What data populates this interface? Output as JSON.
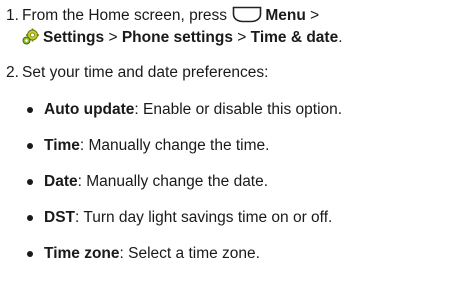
{
  "steps": [
    {
      "number": "1.",
      "line1": {
        "prefix": "From the Home screen, press",
        "key_icon": "menu-key-icon",
        "menu_label": "Menu",
        "arrow": ">"
      },
      "line2": {
        "icon": "settings-icon",
        "settings_label": "Settings",
        "sep1": ">",
        "phone_settings_label": "Phone settings",
        "sep2": ">",
        "time_date_label": "Time & date",
        "end": "."
      }
    },
    {
      "number": "2.",
      "text": "Set your time and date preferences:"
    }
  ],
  "options": [
    {
      "term": "Auto update",
      "desc": ": Enable or disable this option."
    },
    {
      "term": "Time",
      "desc": ": Manually change the time."
    },
    {
      "term": "Date",
      "desc": ": Manually change the date."
    },
    {
      "term": "DST",
      "desc": ": Turn day light savings time on or off."
    },
    {
      "term": "Time zone",
      "desc": ": Select a time zone."
    }
  ]
}
